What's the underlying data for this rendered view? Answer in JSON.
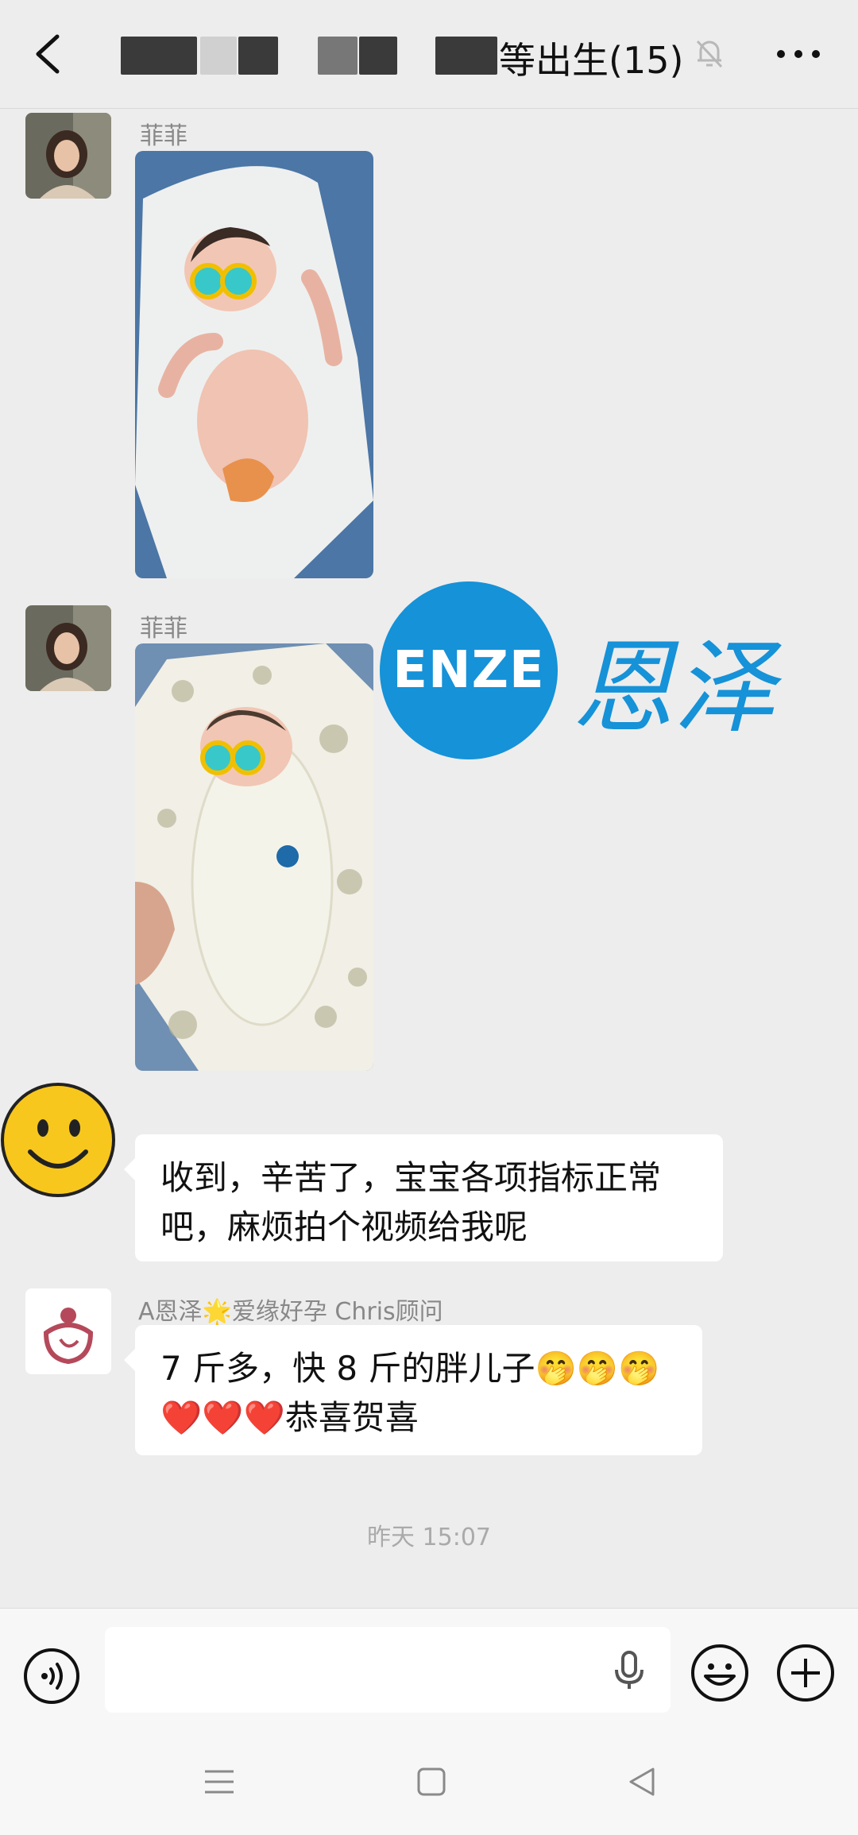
{
  "header": {
    "title": "等出生(15)",
    "back_icon": "chevron-left-icon",
    "mute_icon": "bell-off-icon",
    "more_icon": "ellipsis-icon"
  },
  "messages": [
    {
      "sender": "菲菲",
      "type": "image"
    },
    {
      "sender": "菲菲",
      "type": "image"
    },
    {
      "type": "text",
      "text_line1": "收到，辛苦了，宝宝各项指标正常",
      "text_line2": "吧，麻烦拍个视频给我呢"
    },
    {
      "sender": "A恩泽🌟爱缘好孕 Chris顾问",
      "type": "text",
      "text_line1": "7 斤多，快 8 斤的胖儿子🤭🤭🤭",
      "text_line2": "❤️❤️❤️恭喜贺喜"
    }
  ],
  "timestamp": "昨天 15:07",
  "watermark": {
    "latin": "ENZE",
    "cn": "恩泽"
  },
  "input_bar": {
    "voice_icon": "voice-mode-icon",
    "input_value": "",
    "mic_icon": "microphone-icon",
    "emoji_icon": "emoji-icon",
    "plus_icon": "plus-icon"
  },
  "nav": {
    "menu_icon": "menu-icon",
    "home_icon": "home-square-icon",
    "back_icon": "back-triangle-icon"
  },
  "colors": {
    "accent": "#1592d8",
    "background": "#ededed",
    "bubble": "#ffffff"
  }
}
